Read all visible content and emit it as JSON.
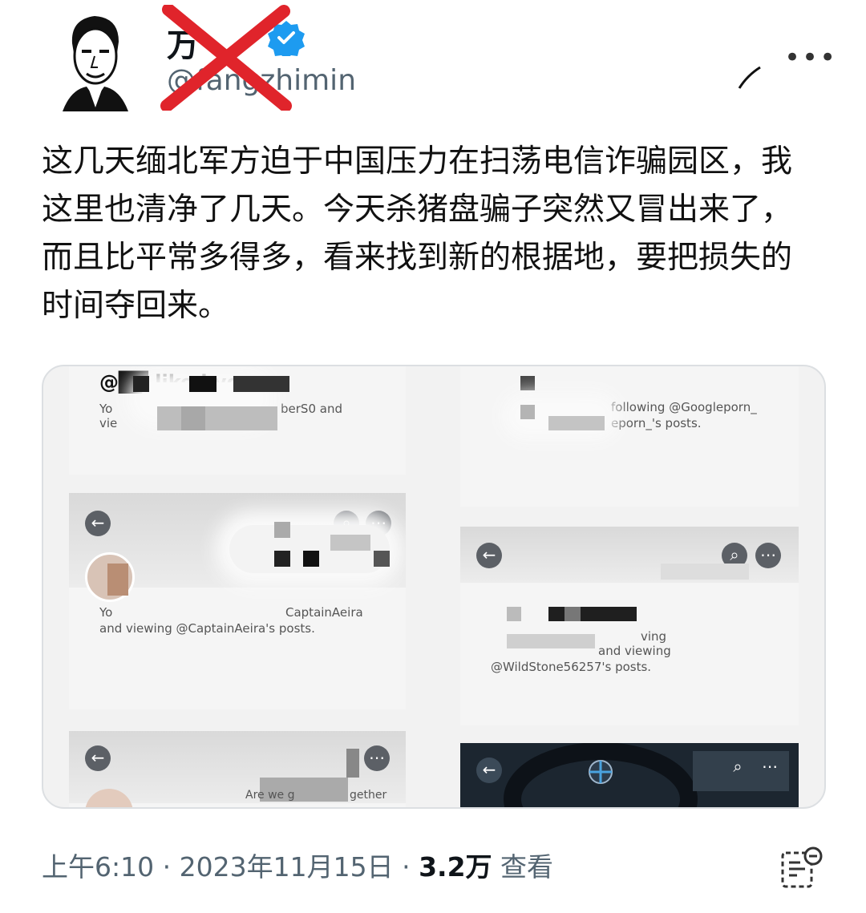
{
  "header": {
    "name_visible": "万",
    "handle": "@fangzhimin",
    "more_icon": "more-dots-icon"
  },
  "tweet": {
    "text": "这几天缅北军方迫于中国压力在扫荡电信诈骗园区，我这里也清净了几天。今天杀猪盘骗子突然又冒出来了，而且比平常多得多，看来找到新的根据地，要把损失的时间夺回来。"
  },
  "media": {
    "panel1": {
      "title": "@██ liked you",
      "line1": "berS0 and",
      "line2a": "Yo",
      "line2b": "vie"
    },
    "panel2": {
      "line1": "following @Googleporn_",
      "line2": "eporn_'s posts."
    },
    "panel3": {
      "line1a": "Yo",
      "line1b": "CaptainAeira",
      "line2": "and viewing @CaptainAeira's posts."
    },
    "panel4": {
      "line1": "ving",
      "line2": "and viewing",
      "line3": "@WildStone56257's posts."
    },
    "panel5": {
      "line1": "Are we g",
      "line2": "gether"
    }
  },
  "footer": {
    "time": "上午6:10",
    "sep1": "·",
    "date": "2023年11月15日",
    "sep2": "·",
    "views_count": "3.2万",
    "views_label": "查看"
  },
  "colors": {
    "verified_blue": "#1d9bf0",
    "cross_red": "#e0242b",
    "muted": "#536471"
  }
}
